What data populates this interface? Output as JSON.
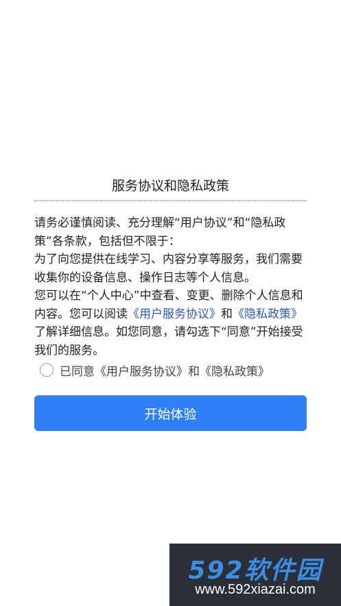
{
  "dialog": {
    "title": "服务协议和隐私政策",
    "body": {
      "p1": "请务必谨慎阅读、充分理解“用户协议”和“隐私政策”各条款，包括但不限于：",
      "p2": "为了向您提供在线学习、内容分享等服务，我们需要收集你的设备信息、操作日志等个人信息。",
      "p3_before": "您可以在“个人中心”中查看、变更、删除个人信息和内容。您可以阅读",
      "link_user_agreement": "《用户服务协议》",
      "p3_and": "和",
      "link_privacy_policy": "《隐私政策》",
      "p3_after": "了解详细信息。如您同意，请勾选下“同意”开始接受我们的服务。"
    },
    "agree_label": "已同意《用户服务协议》和《隐私政策》",
    "start_button_label": "开始体验"
  },
  "watermark": {
    "brand": "592软件园",
    "url": "www.592xiazai.com"
  },
  "colors": {
    "accent": "#2f80f8",
    "link": "#2f56c8",
    "watermark_bg": "#2a2f38",
    "watermark_brand": "#3a8ee8"
  },
  "icons": {
    "agree_checkbox": "radio-circle-icon"
  }
}
